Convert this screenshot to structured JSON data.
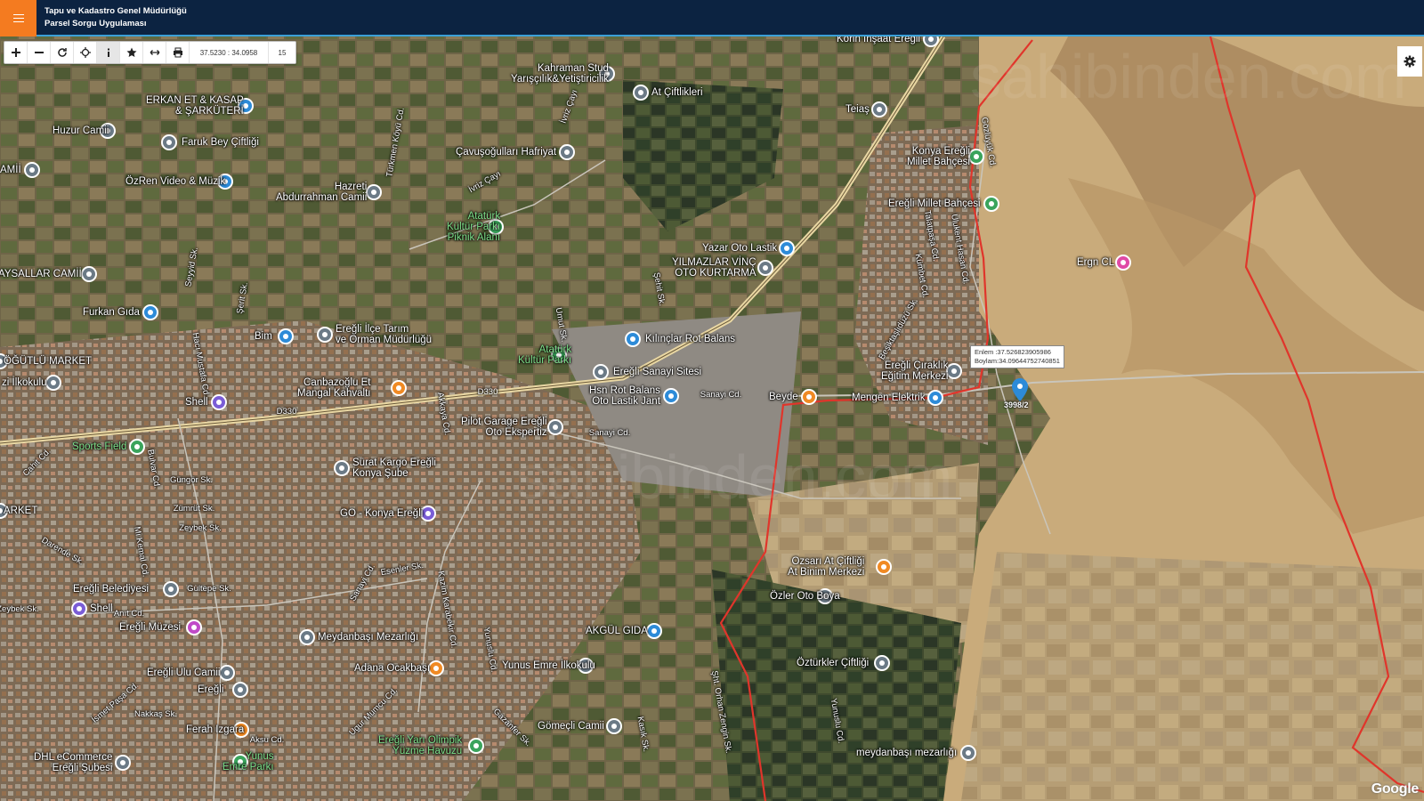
{
  "header": {
    "title_line1": "Tapu ve Kadastro Genel Müdürlüğü",
    "title_line2": "Parsel Sorgu Uygulaması",
    "menu_icon": "hamburger-icon"
  },
  "toolbar": {
    "buttons": [
      "zoom-in-icon",
      "zoom-out-icon",
      "refresh-icon",
      "locate-icon",
      "info-icon",
      "star-icon",
      "measure-icon",
      "print-icon"
    ],
    "coordinates": "37.5230 : 34.0958",
    "zoom_level": "15"
  },
  "settings_icon": "gear-icon",
  "parcel": {
    "number": "3998/2",
    "popup_lat": "Enlem :37.526823905986",
    "popup_lon": "Boylam:34.09644752740851"
  },
  "places": [
    {
      "name": "Kahraman Stud",
      "name2": "Yarışçılık&Yetiştiricilik",
      "color": "#6b7a86"
    },
    {
      "name": "At Çiftlikleri",
      "color": "#6b7a86"
    },
    {
      "name": "Teiaş",
      "color": "#6b7a86"
    },
    {
      "name": "ERKAN ET & KASAP",
      "name2": "& ŞARKÜTERİ",
      "color": "#2d8bd8"
    },
    {
      "name": "Huzur Camii",
      "color": "#6b7a86"
    },
    {
      "name": "Faruk Bey Çiftliği",
      "color": "#6b7a86"
    },
    {
      "name": "Çavuşoğulları Hafriyat",
      "color": "#6b7a86"
    },
    {
      "name": "ÖzRen Video & Müzik",
      "color": "#2d8bd8"
    },
    {
      "name": "Hazreti",
      "name2": "Abdurrahman Camii",
      "color": "#6b7a86"
    },
    {
      "name": "Konya Ereğli",
      "name2": "Millet Bahçesi",
      "color": "#3aa45c"
    },
    {
      "name": "Ereğli Millet Bahçesi",
      "color": "#3aa45c"
    },
    {
      "name": "Atatürk",
      "name2": "Kültür Parkı",
      "name3": "Piknik Alanı",
      "color": "#3aa45c"
    },
    {
      "name": "Yazar Oto Lastik",
      "color": "#2d8bd8"
    },
    {
      "name": "YILMAZLAR VİNÇ",
      "name2": "OTO KURTARMA",
      "color": "#6b7a86"
    },
    {
      "name": "Ergn CL",
      "color": "#e04aa6"
    },
    {
      "name": "AYSALLAR CAMİİ",
      "color": "#6b7a86"
    },
    {
      "name": "Furkan Gıda",
      "color": "#2d8bd8"
    },
    {
      "name": "Bim",
      "color": "#2d8bd8"
    },
    {
      "name": "Ereğli İlçe Tarım",
      "name2": "ve Orman Müdürlüğü",
      "color": "#6b7a86"
    },
    {
      "name": "Kılınçlar Rot Balans",
      "color": "#2d8bd8"
    },
    {
      "name": "Atatürk",
      "name2": "Kültür Parkı",
      "color": "#3aa45c"
    },
    {
      "name": "ÖĞÜTLÜ MARKET",
      "color": "#6b7a86"
    },
    {
      "name": "Ereğli Sanayi Sitesi",
      "color": "#6b7a86"
    },
    {
      "name": "Ereğli Çıraklık",
      "name2": "Eğitim Merkezi",
      "color": "#6b7a86"
    },
    {
      "name": "zi İlkokulu",
      "color": "#6b7a86"
    },
    {
      "name": "Canbazoğlu Et",
      "name2": "Mangal Kahvaltı",
      "color": "#f08a24"
    },
    {
      "name": "Hsn Rot Balans",
      "name2": "Oto Lastik Jant",
      "color": "#2d8bd8"
    },
    {
      "name": "Beyde",
      "color": "#f08a24"
    },
    {
      "name": "Mengen Elektrik",
      "color": "#2d8bd8"
    },
    {
      "name": "Shell",
      "color": "#7a5dd6"
    },
    {
      "name": "Pilot Garage Ereğli",
      "name2": "Oto Ekspertiz",
      "color": "#6b7a86"
    },
    {
      "name": "Sports Field",
      "color": "#3aa45c"
    },
    {
      "name": "Sürat Kargo Ereğli",
      "name2": "Konya Şube",
      "color": "#6b7a86"
    },
    {
      "name": "ARKET",
      "color": "#6b7a86"
    },
    {
      "name": "GO - Konya Ereğli",
      "color": "#7a5dd6"
    },
    {
      "name": "Ozsarı At Çiftliği",
      "name2": "At Binim Merkezi",
      "color": "#f08a24"
    },
    {
      "name": "Özler Oto Boya",
      "color": "#6b7a86"
    },
    {
      "name": "Ereğli Belediyesi",
      "color": "#6b7a86"
    },
    {
      "name": "Shell",
      "color": "#7a5dd6"
    },
    {
      "name": "Ereğli Müzesi",
      "color": "#c04ac8"
    },
    {
      "name": "Meydanbaşı Mezarlığı",
      "color": "#6b7a86"
    },
    {
      "name": "AKGÜL GIDA",
      "color": "#2d8bd8"
    },
    {
      "name": "Öztürkler Çiftliği",
      "color": "#6b7a86"
    },
    {
      "name": "Ereğli Ulu Camii",
      "color": "#6b7a86"
    },
    {
      "name": "Adana Ocakbaşı",
      "color": "#f08a24"
    },
    {
      "name": "Yunus Emre İlkokulu",
      "color": "#6b7a86"
    },
    {
      "name": "Ereğli",
      "color": "#6b7a86"
    },
    {
      "name": "Ferah Izgara",
      "color": "#f08a24"
    },
    {
      "name": "Gömeçli Camii",
      "color": "#6b7a86"
    },
    {
      "name": "DHL eCommerce",
      "name2": "Ereğli Şubesi",
      "color": "#6b7a86"
    },
    {
      "name": "Ereğli Yarı Olimpik",
      "name2": "Yüzme Havuzu",
      "color": "#3aa45c"
    },
    {
      "name": "Yunus",
      "name2": "Emre Parkı",
      "color": "#3aa45c"
    },
    {
      "name": "meydanbaşı mezarlığı",
      "color": "#6b7a86"
    },
    {
      "name": "Korin İnşaat Ereğli",
      "color": "#6b7a86"
    },
    {
      "name": "AMİİ",
      "color": "#6b7a86"
    }
  ],
  "streets": [
    "Türkmen Köyü Cd.",
    "İvriz Çayı",
    "İvriz Çayı",
    "Talatpaşa Cd.",
    "Ulukent Hasan Cd.",
    "Gözlüyük Cd.",
    "Kümbet Cd.",
    "Seyyid Sk.",
    "Şerit Sk.",
    "Hacı Mustafa Cd.",
    "Umut Sk.",
    "Şehit Sk.",
    "Beşiktaşlıdüzü Sk.",
    "Sanayi Cd.",
    "Sanayi Cd.",
    "D330",
    "D330",
    "Akkaya Cd.",
    "Bulvar Cd.",
    "Cahit Cd.",
    "Güngör Sk.",
    "Zümrüt Sk.",
    "Zeybek Sk.",
    "Darende Sk.",
    "Mi Kemal Cd.",
    "Esenler Sk.",
    "Kazım Karabekir Cd.",
    "Sanayi Cd.",
    "Gültepe Sk.",
    "Zeybek Sk.",
    "Anıt Cd.",
    "Yunuslu Cd.",
    "Ugur Mumcu Cd.",
    "Gazanfer Sk.",
    "Şht. Orhan Zengin Sk.",
    "Yunuslu Cd.",
    "İsmet Paşa Cd.",
    "Nakkaş Sk.",
    "Aksu Cd.",
    "Kasık Sk."
  ],
  "attribution": "Google"
}
